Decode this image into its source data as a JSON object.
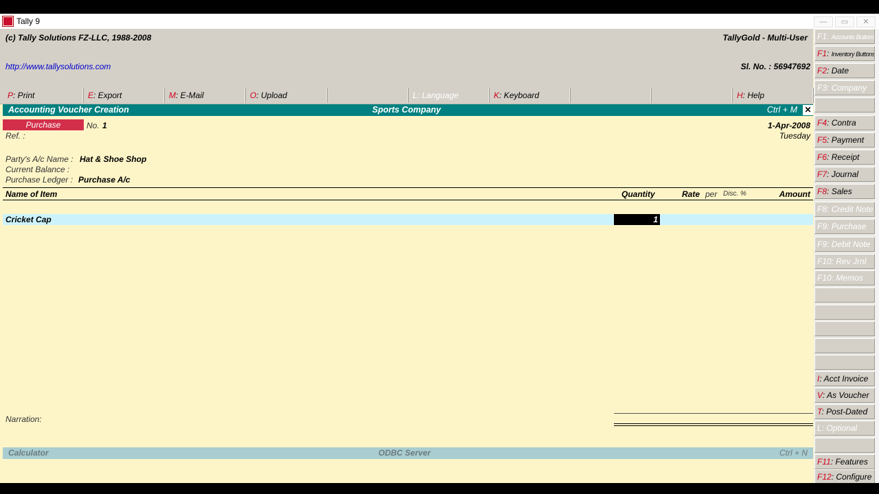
{
  "window": {
    "title": "Tally 9",
    "controls": [
      "—",
      "▭",
      "✕"
    ]
  },
  "header": {
    "copyright": "(c) Tally Solutions FZ-LLC, 1988-2008",
    "product": "TallyGold - Multi-User",
    "url": "http://www.tallysolutions.com",
    "serial": "Sl. No. : 56947692"
  },
  "menu": [
    {
      "key": "P",
      "label": ": Print",
      "disabled": false
    },
    {
      "key": "E",
      "label": ": Export",
      "disabled": false
    },
    {
      "key": "M",
      "label": ": E-Mail",
      "disabled": false
    },
    {
      "key": "O",
      "label": ": Upload",
      "disabled": false
    },
    {
      "key": "",
      "label": "",
      "disabled": true
    },
    {
      "key": "L",
      "label": ": Language",
      "disabled": true
    },
    {
      "key": "K",
      "label": ": Keyboard",
      "disabled": false
    },
    {
      "key": "",
      "label": "",
      "disabled": true
    },
    {
      "key": "",
      "label": "",
      "disabled": true
    },
    {
      "key": "H",
      "label": ": Help",
      "disabled": false
    }
  ],
  "voucher_bar": {
    "title": "Accounting Voucher  Creation",
    "company": "Sports Company",
    "shortcut": "Ctrl + M",
    "close": "✕"
  },
  "voucher": {
    "type": "Purchase",
    "number_label": "No.",
    "number": "1",
    "date": "1-Apr-2008",
    "day": "Tuesday",
    "ref_label": "Ref. :",
    "party_label": "Party's A/c Name :",
    "party_value": "Hat & Shoe Shop",
    "balance_label": "Current Balance :",
    "ledger_label": "Purchase Ledger :",
    "ledger_value": "Purchase A/c"
  },
  "columns": {
    "name": "Name of Item",
    "quantity": "Quantity",
    "rate": "Rate",
    "per": "per",
    "disc": "Disc. %",
    "amount": "Amount"
  },
  "items": [
    {
      "name": "Cricket Cap",
      "quantity": "1"
    }
  ],
  "narration_label": "Narration:",
  "calc_bar": {
    "left": "Calculator",
    "center": "ODBC Server",
    "right": "Ctrl + N"
  },
  "sidebar": [
    {
      "key": "F1",
      "label": "Accounts Buttons",
      "disabled": true,
      "tiny": true
    },
    {
      "key": "F1",
      "label": "Inventory Buttons",
      "disabled": false,
      "tiny": true
    },
    {
      "key": "F2",
      "label": "Date",
      "disabled": false
    },
    {
      "key": "F3",
      "label": "Company",
      "disabled": true
    },
    {
      "key": "",
      "label": "",
      "disabled": true
    },
    {
      "key": "F4",
      "label": "Contra",
      "disabled": false
    },
    {
      "key": "F5",
      "label": "Payment",
      "disabled": false
    },
    {
      "key": "F6",
      "label": "Receipt",
      "disabled": false
    },
    {
      "key": "F7",
      "label": "Journal",
      "disabled": false
    },
    {
      "key": "F8",
      "label": "Sales",
      "disabled": false
    },
    {
      "key": "F8",
      "label": "Credit Note",
      "disabled": true
    },
    {
      "key": "F9",
      "label": "Purchase",
      "disabled": true
    },
    {
      "key": "F9",
      "label": "Debit Note",
      "disabled": true
    },
    {
      "key": "F10",
      "label": "Rev Jrnl",
      "disabled": true
    },
    {
      "key": "F10",
      "label": "Memos",
      "disabled": true
    },
    {
      "key": "",
      "label": "",
      "disabled": true
    },
    {
      "key": "",
      "label": "",
      "disabled": true
    },
    {
      "key": "",
      "label": "",
      "disabled": true
    },
    {
      "key": "",
      "label": "",
      "disabled": true
    },
    {
      "key": "",
      "label": "",
      "disabled": true
    },
    {
      "key": "I",
      "label": "Acct Invoice",
      "disabled": false
    },
    {
      "key": "V",
      "label": "As Voucher",
      "disabled": false
    },
    {
      "key": "T",
      "label": "Post-Dated",
      "disabled": false
    },
    {
      "key": "L",
      "label": "Optional",
      "disabled": true
    },
    {
      "key": "",
      "label": "",
      "disabled": true
    },
    {
      "key": "F11",
      "label": "Features",
      "disabled": false
    },
    {
      "key": "F12",
      "label": "Configure",
      "disabled": false
    }
  ]
}
